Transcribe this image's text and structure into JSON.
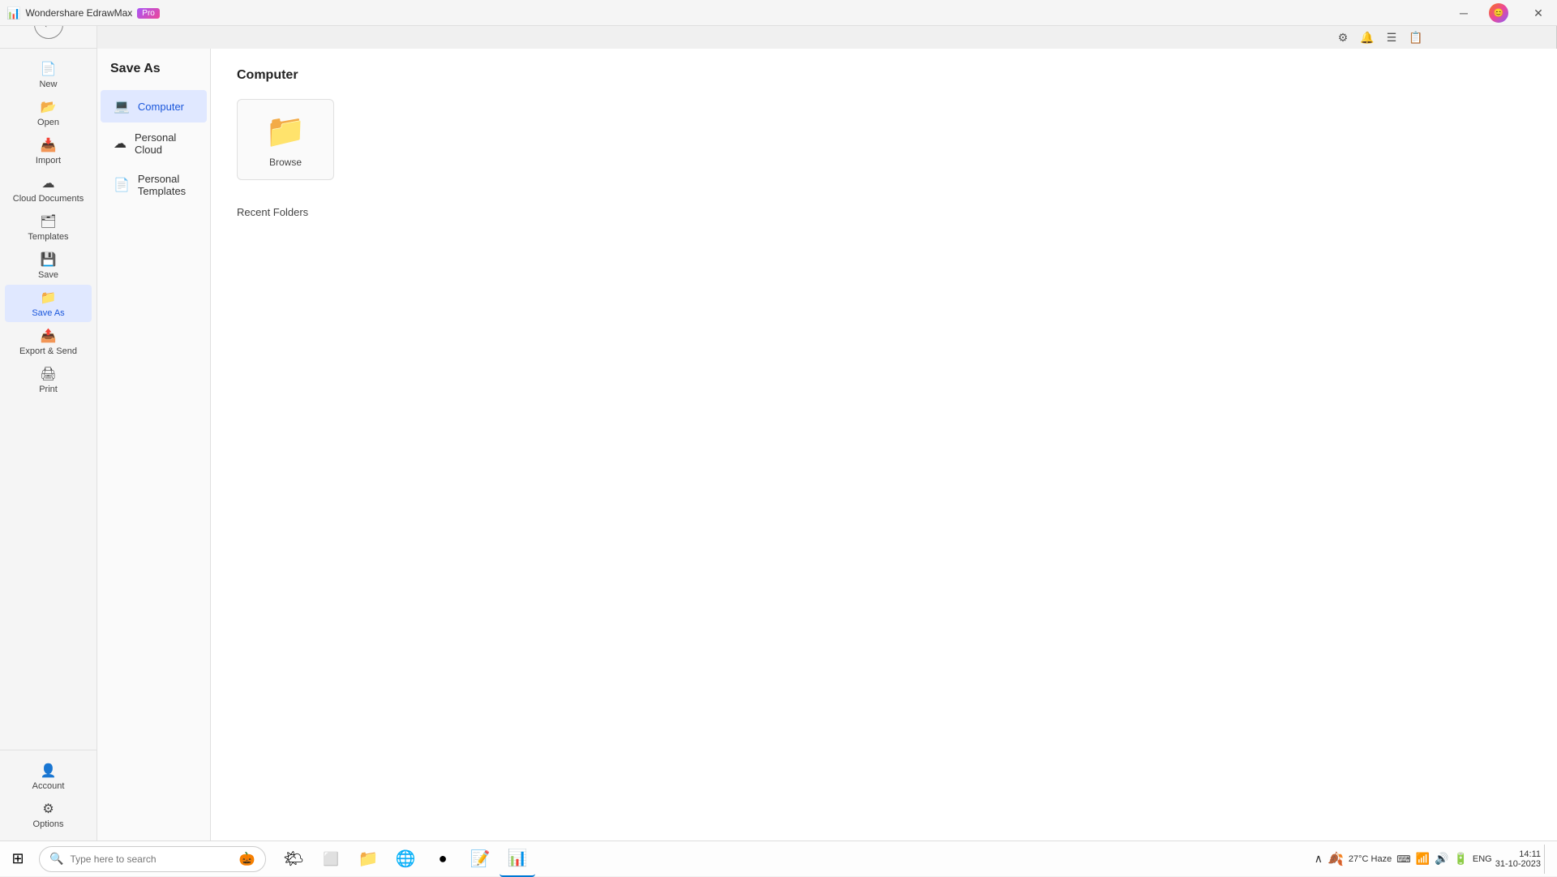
{
  "app": {
    "title": "Wondershare EdrawMax",
    "pro_badge": "Pro"
  },
  "titlebar": {
    "minimize_label": "─",
    "restore_label": "⧉",
    "close_label": "✕"
  },
  "toolbar": {
    "icons": [
      "⚙",
      "🔔",
      "☰",
      "📋"
    ]
  },
  "left_sidebar": {
    "items": [
      {
        "id": "new",
        "label": "New",
        "icon": "📄"
      },
      {
        "id": "open",
        "label": "Open",
        "icon": "📂"
      },
      {
        "id": "import",
        "label": "Import",
        "icon": "📥"
      },
      {
        "id": "cloud",
        "label": "Cloud Documents",
        "icon": "☁"
      },
      {
        "id": "templates",
        "label": "Templates",
        "icon": "🗂"
      },
      {
        "id": "save",
        "label": "Save",
        "icon": "💾"
      },
      {
        "id": "save-as",
        "label": "Save As",
        "icon": "📁",
        "active": true
      },
      {
        "id": "export",
        "label": "Export & Send",
        "icon": "📤"
      },
      {
        "id": "print",
        "label": "Print",
        "icon": "🖨"
      }
    ],
    "bottom": [
      {
        "id": "account",
        "label": "Account",
        "icon": "👤"
      },
      {
        "id": "options",
        "label": "Options",
        "icon": "⚙"
      }
    ]
  },
  "middle_panel": {
    "title": "Save As",
    "options": [
      {
        "id": "computer",
        "label": "Computer",
        "icon": "💻",
        "active": true
      },
      {
        "id": "personal-cloud",
        "label": "Personal Cloud",
        "icon": "☁"
      },
      {
        "id": "personal-templates",
        "label": "Personal Templates",
        "icon": "📄"
      }
    ]
  },
  "main_content": {
    "section_title": "Computer",
    "folder_card": {
      "icon": "📁",
      "label": "Browse"
    },
    "recent_section_title": "Recent Folders"
  },
  "taskbar": {
    "search_placeholder": "Type here to search",
    "apps": [
      {
        "id": "start",
        "icon": "⊞"
      },
      {
        "id": "widgets",
        "icon": "🌤"
      },
      {
        "id": "file-explorer",
        "icon": "📁"
      },
      {
        "id": "edge",
        "icon": "🌐"
      },
      {
        "id": "chrome",
        "icon": "🔵"
      },
      {
        "id": "word",
        "icon": "📝"
      },
      {
        "id": "edrawmax",
        "icon": "📊",
        "active": true
      }
    ],
    "sys_tray": {
      "weather": "27°C  Haze",
      "time": "14:11",
      "date": "31-10-2023",
      "lang": "ENG"
    }
  }
}
